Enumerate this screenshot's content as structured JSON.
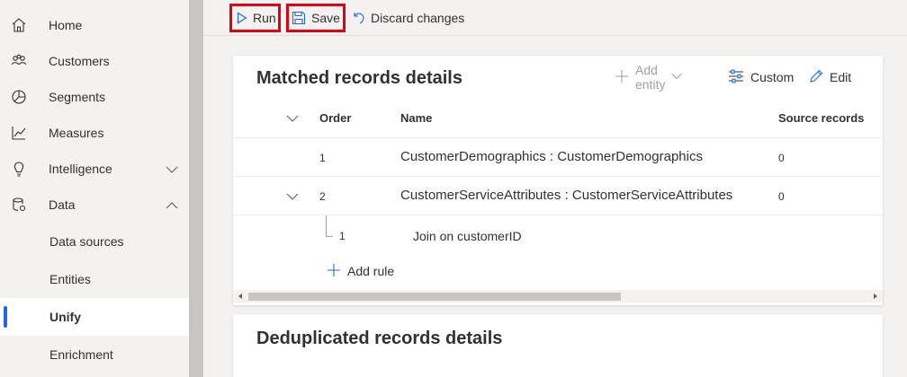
{
  "sidebar": {
    "items": [
      {
        "label": "Home",
        "icon": "home-icon"
      },
      {
        "label": "Customers",
        "icon": "people-icon"
      },
      {
        "label": "Segments",
        "icon": "segments-icon"
      },
      {
        "label": "Measures",
        "icon": "chart-line-icon"
      },
      {
        "label": "Intelligence",
        "icon": "lightbulb-icon"
      },
      {
        "label": "Data",
        "icon": "database-icon"
      }
    ],
    "subitems": [
      {
        "label": "Data sources"
      },
      {
        "label": "Entities"
      },
      {
        "label": "Unify",
        "active": true
      },
      {
        "label": "Enrichment"
      }
    ]
  },
  "toolbar": {
    "run_label": "Run",
    "save_label": "Save",
    "discard_label": "Discard changes"
  },
  "matched_card": {
    "title": "Matched records details",
    "actions": {
      "add_entity": "Add entity",
      "custom": "Custom",
      "edit": "Edit"
    },
    "columns": {
      "order": "Order",
      "name": "Name",
      "source_records": "Source records"
    },
    "rows": [
      {
        "order": "1",
        "name": "CustomerDemographics : CustomerDemographics",
        "source_records": "0"
      },
      {
        "order": "2",
        "name": "CustomerServiceAttributes : CustomerServiceAttributes",
        "source_records": "0"
      }
    ],
    "subrow": {
      "order": "1",
      "name": "Join on customerID"
    },
    "add_rule": "Add rule"
  },
  "dedup_card": {
    "title": "Deduplicated records details"
  },
  "colors": {
    "accent": "#2266e3",
    "highlight": "#e00012",
    "icon_blue": "#2266e3"
  }
}
